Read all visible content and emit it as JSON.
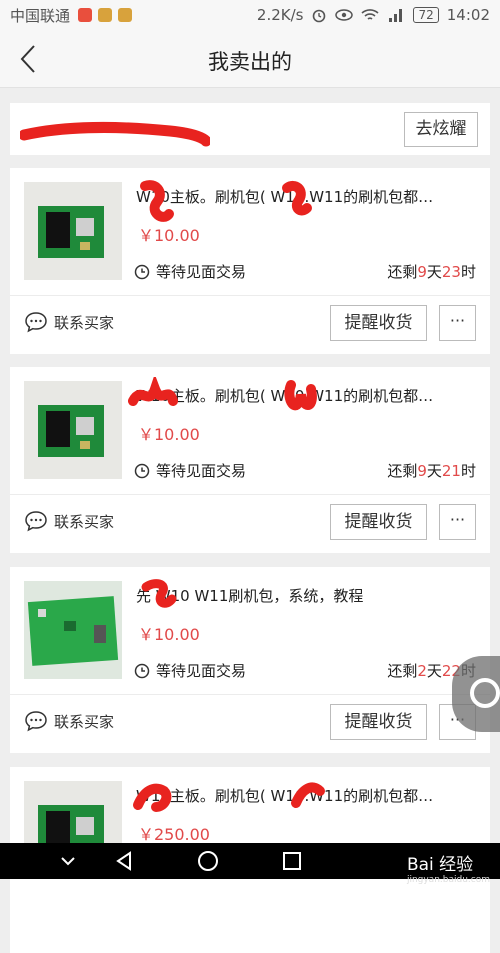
{
  "status_bar": {
    "carrier": "中国联通",
    "network_speed": "2.2K/s",
    "battery": "72",
    "time": "14:02"
  },
  "header": {
    "title": "我卖出的"
  },
  "promo": {
    "button_label": "去炫耀"
  },
  "orders": [
    {
      "description": "  W10主板。刷机包(   W10.W11的刷机包都…",
      "price": "￥10.00",
      "status": "等待见面交易",
      "countdown": {
        "prefix": "还剩",
        "days": "9",
        "day_unit": "天",
        "hours": "23",
        "hour_unit": "时"
      },
      "contact_label": "联系买家",
      "remind_label": "提醒收货",
      "more_label": "···"
    },
    {
      "description": "   W10主板。刷机包(   W10.W11的刷机包都…",
      "price": "￥10.00",
      "status": "等待见面交易",
      "countdown": {
        "prefix": "还剩",
        "days": "9",
        "day_unit": "天",
        "hours": "21",
        "hour_unit": "时"
      },
      "contact_label": "联系买家",
      "remind_label": "提醒收货",
      "more_label": "···"
    },
    {
      "description": "先  W10   W11刷机包，系统，教程",
      "price": "￥10.00",
      "status": "等待见面交易",
      "countdown": {
        "prefix": "还剩",
        "days": "2",
        "day_unit": "天",
        "hours": "22",
        "hour_unit": "时"
      },
      "contact_label": "联系买家",
      "remind_label": "提醒收货",
      "more_label": "···"
    },
    {
      "description": "   W10主板。刷机包(   W10.W11的刷机包都…",
      "price": "￥250.00"
    }
  ],
  "watermark": {
    "brand": "Bai 经验",
    "url": "jingyan.baidu.com"
  },
  "colors": {
    "accent_red": "#e14a4a",
    "redaction": "#e8231f"
  }
}
